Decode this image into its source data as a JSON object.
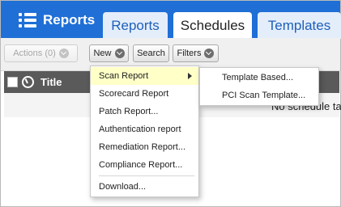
{
  "app": {
    "title": "Reports"
  },
  "tabs": [
    {
      "label": "Reports",
      "active": false
    },
    {
      "label": "Schedules",
      "active": true
    },
    {
      "label": "Templates",
      "active": false
    }
  ],
  "toolbar": {
    "actions_label": "Actions (0)",
    "new_label": "New",
    "search_label": "Search",
    "filters_label": "Filters"
  },
  "table": {
    "columns": [
      "Title"
    ],
    "empty_message": "No schedule ta"
  },
  "new_menu": {
    "items": [
      "Scan Report",
      "Scorecard Report",
      "Patch Report...",
      "Authentication report",
      "Remediation Report...",
      "Compliance Report...",
      "Download..."
    ]
  },
  "scan_report_submenu": {
    "items": [
      "Template Based...",
      "PCI Scan Template..."
    ]
  },
  "colors": {
    "header_blue": "#1f6fd6",
    "highlight": "#ffffc8",
    "table_header": "#5a5a5a"
  }
}
